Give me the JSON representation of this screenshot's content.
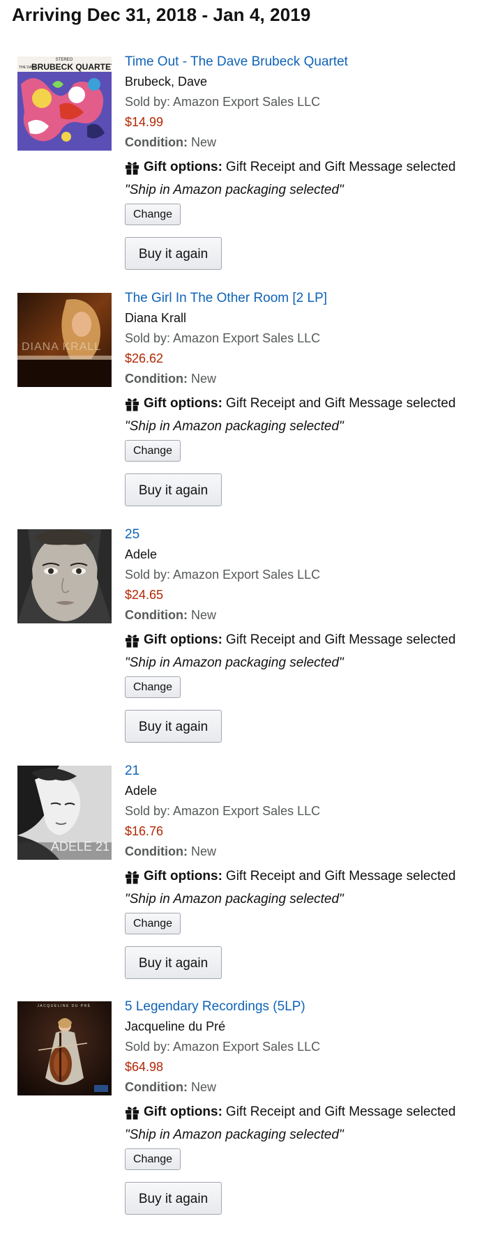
{
  "heading": "Arriving Dec 31, 2018 - Jan 4, 2019",
  "colors": {
    "link": "#0f63b8",
    "price": "#b12704",
    "muted": "#565959",
    "text": "#111111"
  },
  "items": [
    {
      "title": "Time Out - The Dave Brubeck Quartet",
      "artist": "Brubeck, Dave",
      "seller": "Sold by: Amazon Export Sales LLC",
      "price": "$14.99",
      "condition_label": "Condition:",
      "condition_value": "New",
      "gift_label": "Gift options:",
      "gift_value": "Gift Receipt and Gift Message selected",
      "ship_note": "\"Ship in Amazon packaging selected\"",
      "change_label": "Change",
      "buy_label": "Buy it again",
      "cover_text_top": "STEREO",
      "cover_text_main": "BRUBECK QUARTET",
      "cover_text_small": "THE DAVE"
    },
    {
      "title": "The Girl In The Other Room [2 LP]",
      "artist": "Diana Krall",
      "seller": "Sold by: Amazon Export Sales LLC",
      "price": "$26.62",
      "condition_label": "Condition:",
      "condition_value": "New",
      "gift_label": "Gift options:",
      "gift_value": "Gift Receipt and Gift Message selected",
      "ship_note": "\"Ship in Amazon packaging selected\"",
      "change_label": "Change",
      "buy_label": "Buy it again",
      "cover_text_main": "DIANA KRALL"
    },
    {
      "title": "25",
      "artist": "Adele",
      "seller": "Sold by: Amazon Export Sales LLC",
      "price": "$24.65",
      "condition_label": "Condition:",
      "condition_value": "New",
      "gift_label": "Gift options:",
      "gift_value": "Gift Receipt and Gift Message selected",
      "ship_note": "\"Ship in Amazon packaging selected\"",
      "change_label": "Change",
      "buy_label": "Buy it again"
    },
    {
      "title": "21",
      "artist": "Adele",
      "seller": "Sold by: Amazon Export Sales LLC",
      "price": "$16.76",
      "condition_label": "Condition:",
      "condition_value": "New",
      "gift_label": "Gift options:",
      "gift_value": "Gift Receipt and Gift Message selected",
      "ship_note": "\"Ship in Amazon packaging selected\"",
      "change_label": "Change",
      "buy_label": "Buy it again",
      "cover_text_main": "ADELE 21"
    },
    {
      "title": "5 Legendary Recordings (5LP)",
      "artist": "Jacqueline du Pré",
      "seller": "Sold by: Amazon Export Sales LLC",
      "price": "$64.98",
      "condition_label": "Condition:",
      "condition_value": "New",
      "gift_label": "Gift options:",
      "gift_value": "Gift Receipt and Gift Message selected",
      "ship_note": "\"Ship in Amazon packaging selected\"",
      "change_label": "Change",
      "buy_label": "Buy it again",
      "cover_text_top": "JACQUELINE DU PRÉ"
    }
  ]
}
